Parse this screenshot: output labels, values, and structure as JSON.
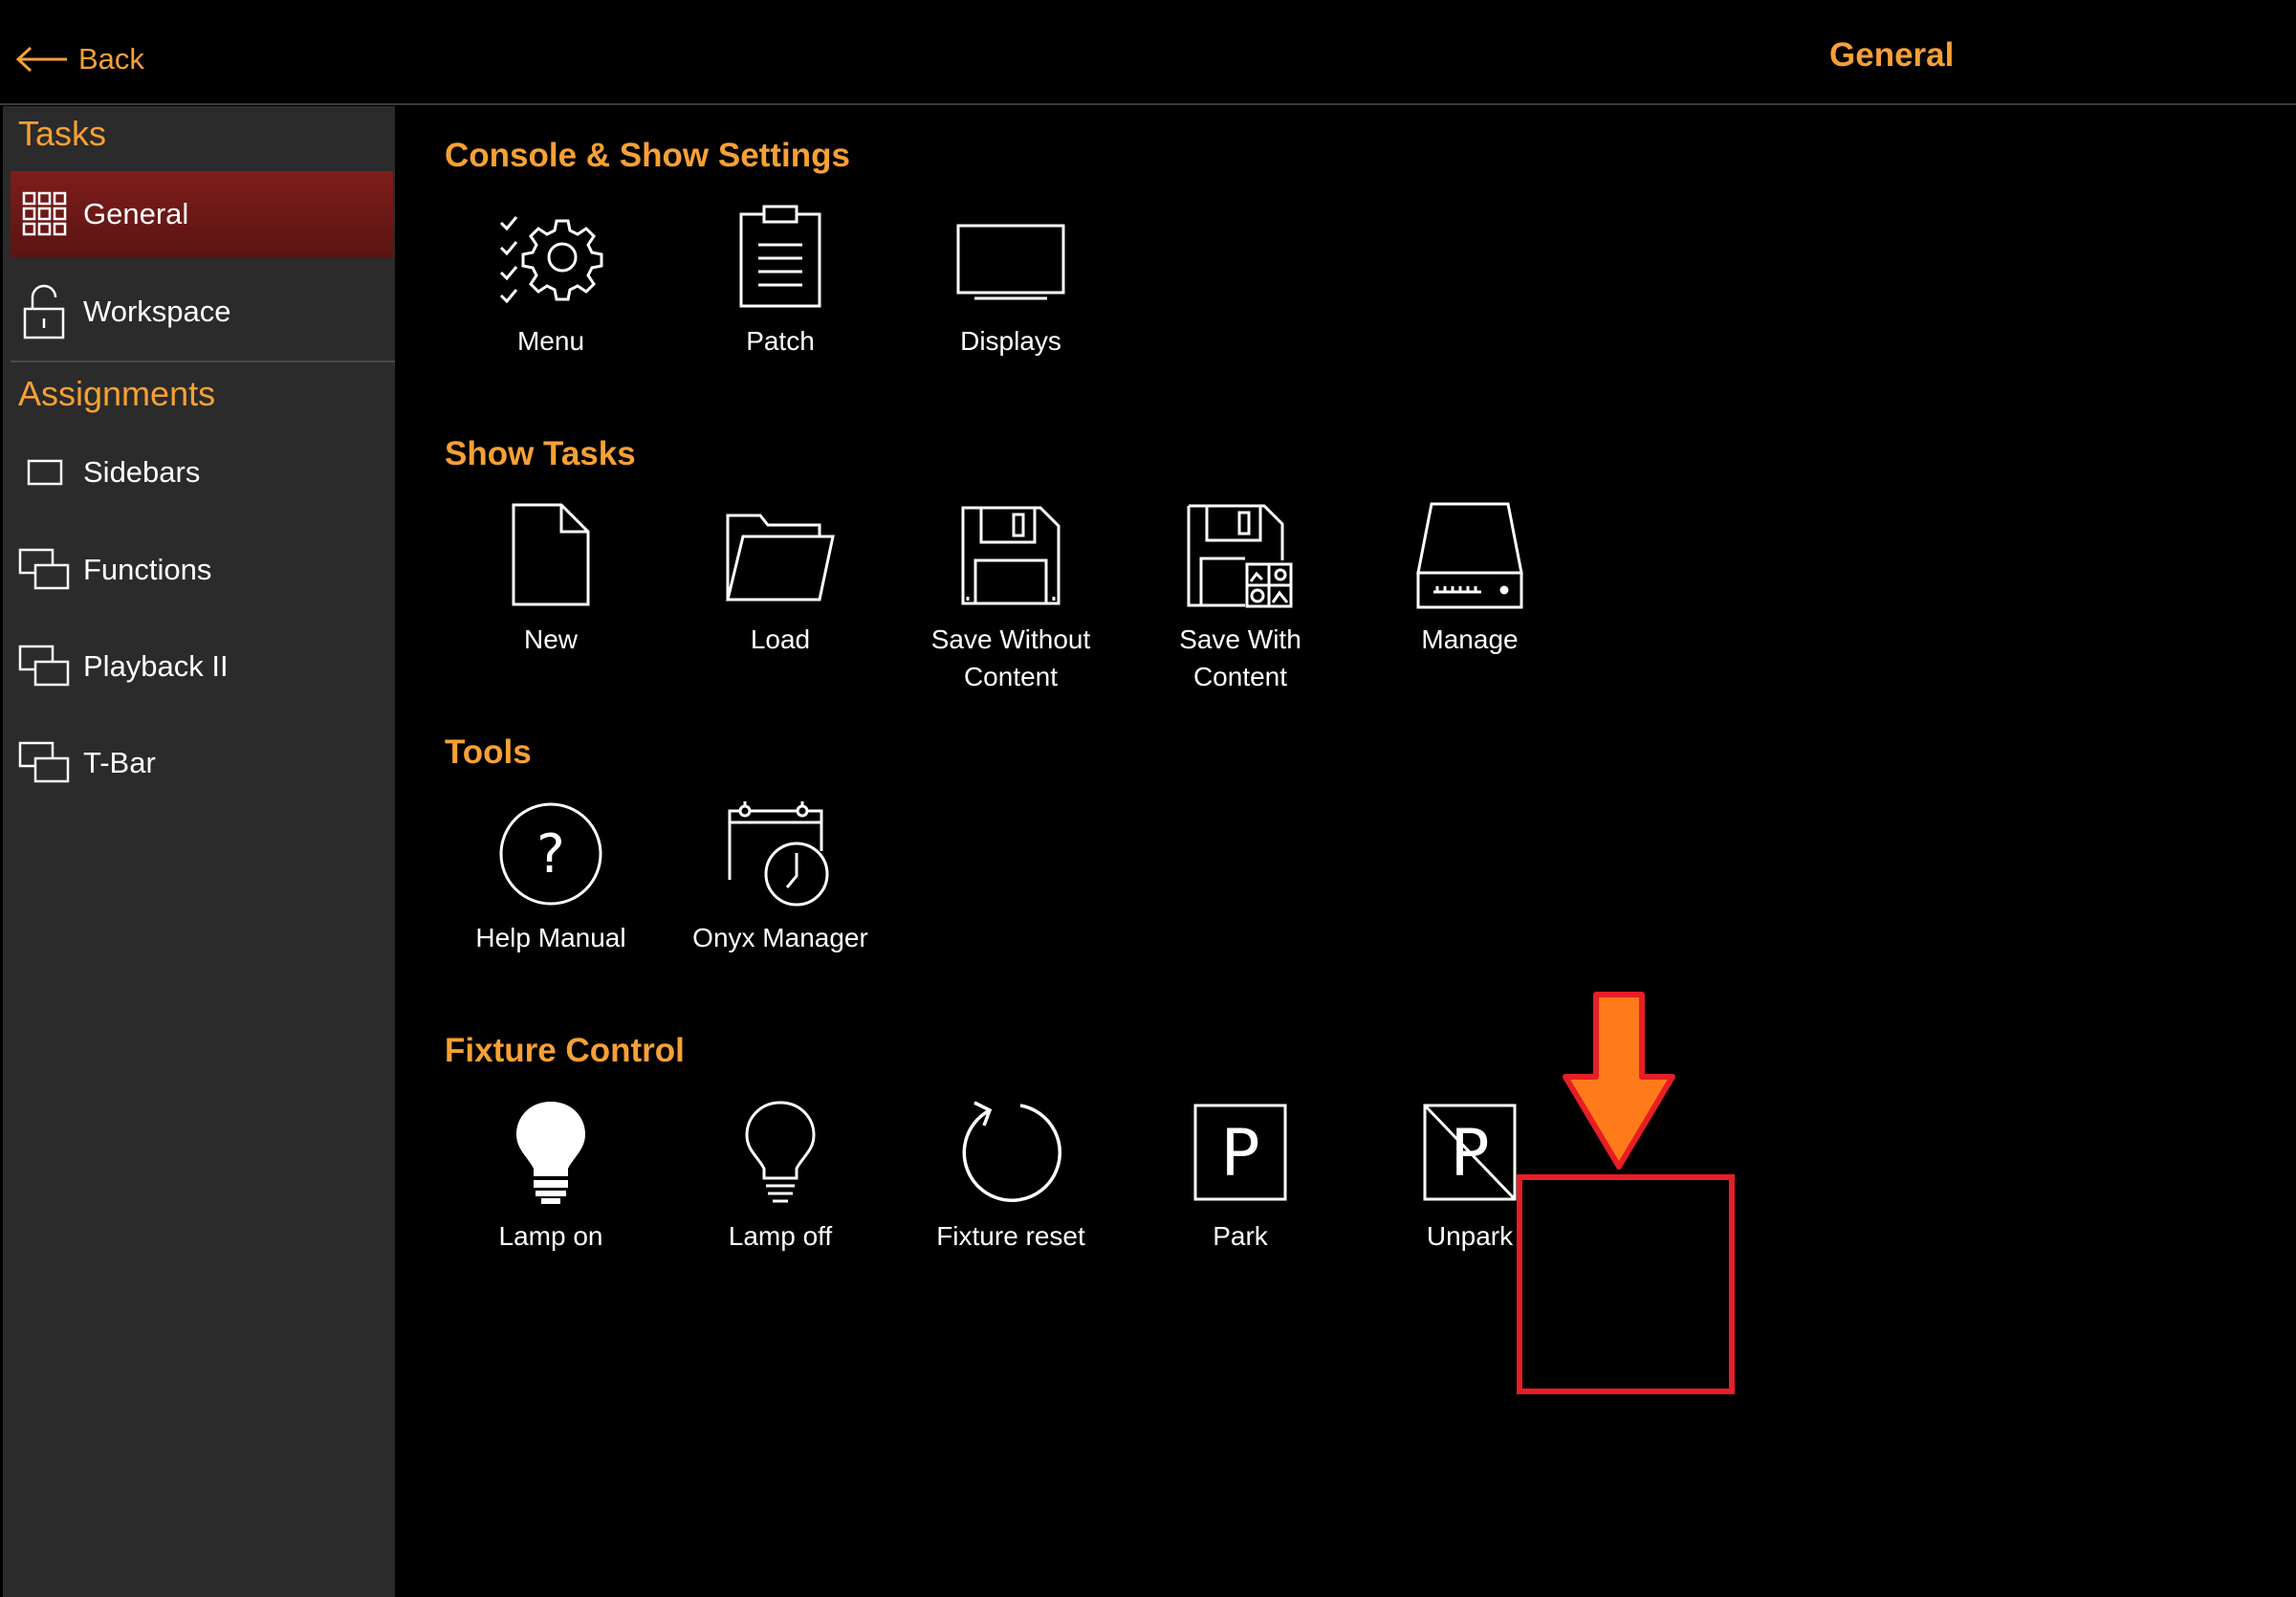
{
  "header": {
    "back_label": "Back",
    "title": "General"
  },
  "sidebar": {
    "tasks_heading": "Tasks",
    "assignments_heading": "Assignments",
    "tasks": [
      {
        "label": "General",
        "icon": "grid-icon",
        "active": true
      },
      {
        "label": "Workspace",
        "icon": "lock-open-icon",
        "active": false
      }
    ],
    "assignments": [
      {
        "label": "Sidebars",
        "icon": "window-icon"
      },
      {
        "label": "Functions",
        "icon": "stacked-windows-icon"
      },
      {
        "label": "Playback II",
        "icon": "stacked-windows-icon"
      },
      {
        "label": "T-Bar",
        "icon": "stacked-windows-icon"
      }
    ]
  },
  "sections": {
    "console": {
      "title": "Console & Show Settings",
      "items": [
        {
          "label": "Menu",
          "icon": "settings-checklist-icon"
        },
        {
          "label": "Patch",
          "icon": "clipboard-icon"
        },
        {
          "label": "Displays",
          "icon": "monitor-icon"
        }
      ]
    },
    "show_tasks": {
      "title": "Show Tasks",
      "items": [
        {
          "label": "New",
          "icon": "new-file-icon"
        },
        {
          "label": "Load",
          "icon": "folder-icon"
        },
        {
          "label": "Save Without Content",
          "label_line1": "Save Without",
          "label_line2": "Content",
          "icon": "floppy-icon"
        },
        {
          "label": "Save With Content",
          "label_line1": "Save With",
          "label_line2": "Content",
          "icon": "floppy-content-icon"
        },
        {
          "label": "Manage",
          "icon": "drive-icon"
        }
      ]
    },
    "tools": {
      "title": "Tools",
      "items": [
        {
          "label": "Help Manual",
          "icon": "help-icon"
        },
        {
          "label": "Onyx Manager",
          "icon": "calendar-clock-icon"
        }
      ]
    },
    "fixture_control": {
      "title": "Fixture Control",
      "items": [
        {
          "label": "Lamp on",
          "icon": "bulb-filled-icon"
        },
        {
          "label": "Lamp off",
          "icon": "bulb-outline-icon"
        },
        {
          "label": "Fixture reset",
          "icon": "reset-icon"
        },
        {
          "label": "Park",
          "icon": "park-icon",
          "highlighted": true
        },
        {
          "label": "Unpark",
          "icon": "unpark-icon"
        }
      ]
    }
  },
  "colors": {
    "accent": "#f7a035",
    "active_item": "#7e1d1b",
    "highlight_box": "#e61e25",
    "arrow": "#ff7a1a"
  }
}
